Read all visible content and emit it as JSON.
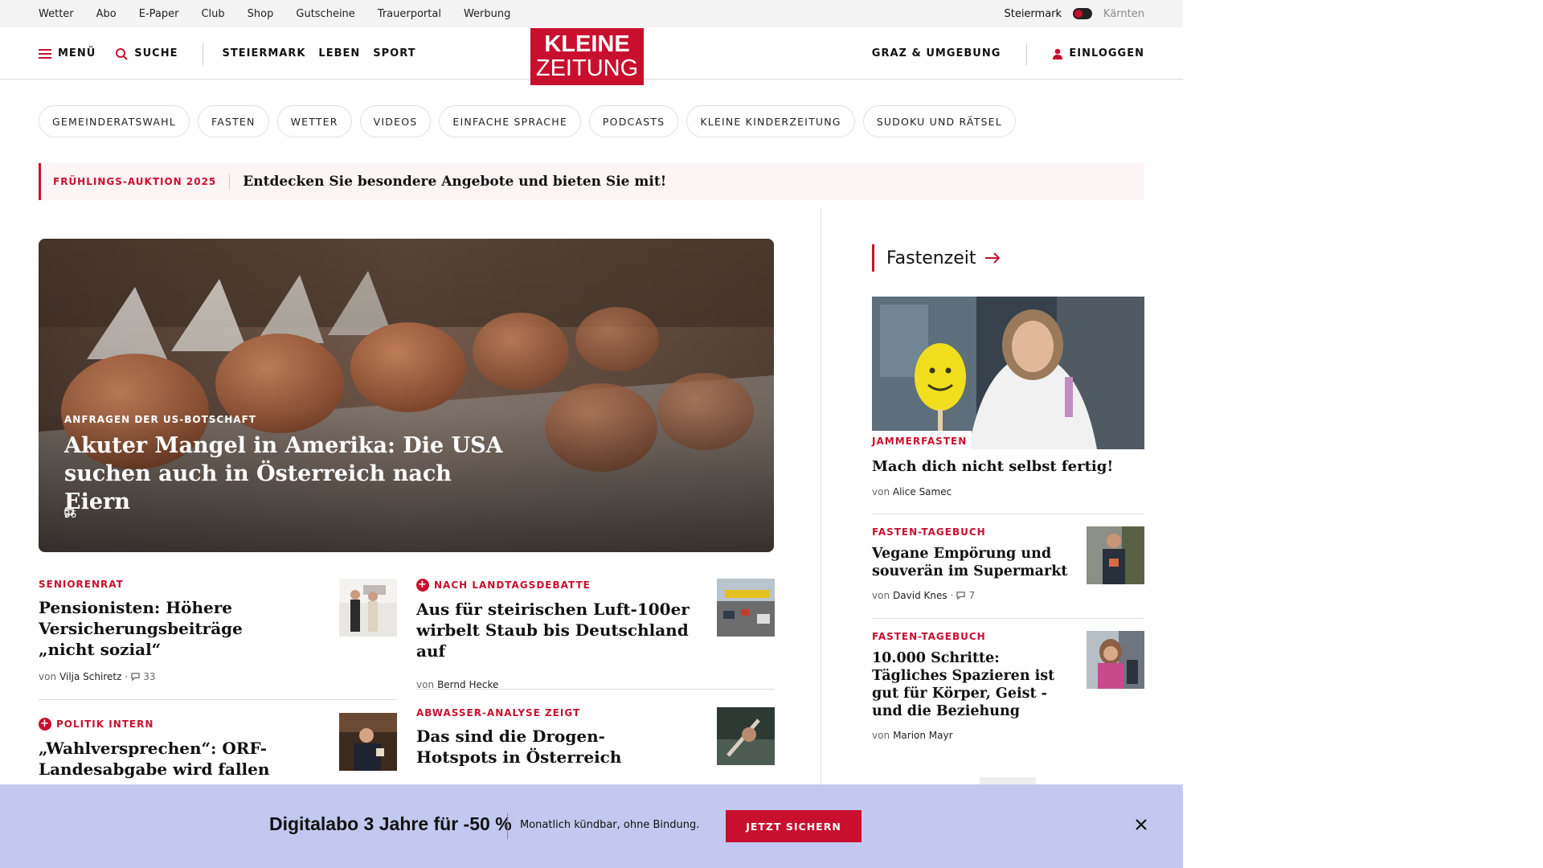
{
  "utility": {
    "links": [
      "Wetter",
      "Abo",
      "E-Paper",
      "Club",
      "Shop",
      "Gutscheine",
      "Trauerportal",
      "Werbung"
    ],
    "region_active": "Steiermark",
    "region_inactive": "Kärnten"
  },
  "header": {
    "menu": "MENÜ",
    "search": "SUCHE",
    "nav": [
      "STEIERMARK",
      "LEBEN",
      "SPORT"
    ],
    "logo_line1": "KLEINE",
    "logo_line2": "ZEITUNG",
    "location": "GRAZ & UMGEBUNG",
    "login": "EINLOGGEN"
  },
  "chips": [
    "GEMEINDERATSWAHL",
    "FASTEN",
    "WETTER",
    "VIDEOS",
    "EINFACHE SPRACHE",
    "PODCASTS",
    "KLEINE KINDERZEITUNG",
    "SUDOKU UND RÄTSEL"
  ],
  "promo": {
    "tag": "FRÜHLINGS-AUKTION 2025",
    "text": "Entdecken Sie besondere Angebote und bieten Sie mit!"
  },
  "hero": {
    "kicker": "ANFRAGEN DER US-BOTSCHAFT",
    "title": "Akuter Mangel in Amerika: Die USA suchen auch in Österreich nach Eiern",
    "comments": "36"
  },
  "articles": [
    {
      "kicker": "SENIORENRAT",
      "title": "Pensionisten: Höhere Versicherungsbeiträge „nicht sozial“",
      "by": "von",
      "author": "Vilja Schiretz",
      "comments": "33"
    },
    {
      "kicker": "NACH LANDTAGSDEBATTE",
      "title": "Aus für steirischen Luft-100er wirbelt Staub bis Deutschland auf",
      "by": "von",
      "author": "Bernd Hecke"
    },
    {
      "kicker": "POLITIK INTERN",
      "title": "„Wahlversprechen“: ORF-Landesabgabe wird fallen"
    },
    {
      "kicker": "ABWASSER-ANALYSE ZEIGT",
      "title": "Das sind die Drogen-Hotspots in Österreich"
    }
  ],
  "sidebar": {
    "heading": "Fastenzeit",
    "feature": {
      "kicker": "JAMMERFASTEN",
      "title": "Mach dich nicht selbst fertig!",
      "by": "von",
      "author": "Alice Samec"
    },
    "items": [
      {
        "kicker": "FASTEN-TAGEBUCH",
        "title": "Vegane Empörung und souverän im Supermarkt",
        "by": "von",
        "author": "David Knes",
        "comments": "7"
      },
      {
        "kicker": "FASTEN-TAGEBUCH",
        "title": "10.000 Schritte: Tägliches Spazieren ist gut für Körper, Geist - und die Beziehung",
        "by": "von",
        "author": "Marion Mayr"
      }
    ]
  },
  "banner": {
    "headline": "Digitalabo 3 Jahre für -50 %",
    "sub": "Monatlich kündbar, ohne Bindung.",
    "cta": "JETZT SICHERN"
  },
  "icons": [
    "hamburger-icon",
    "search-icon",
    "user-icon",
    "arrow-right-icon",
    "comment-icon",
    "plus-icon",
    "close-icon"
  ],
  "colors": {
    "brand": "#c8102e",
    "banner_bg": "#c2c8ef",
    "promo_bg": "#fcf4f5"
  }
}
